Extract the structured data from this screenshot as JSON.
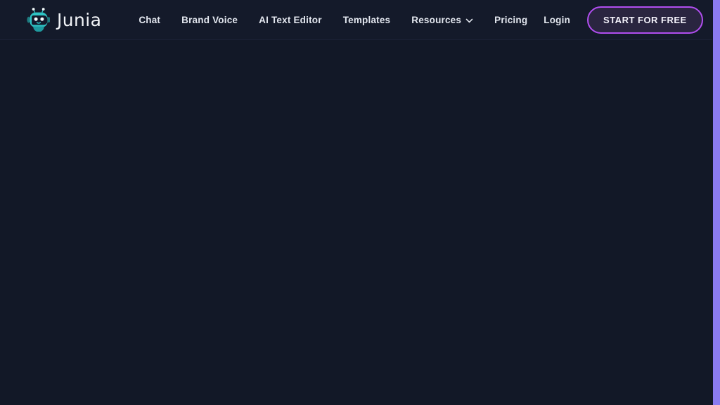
{
  "site": {
    "brand_name": "Junia",
    "brand_icon": "robot-mascot-icon",
    "background_color": "#121827",
    "header_color": "#141a2a",
    "accent_color": "#b14ef0",
    "logo_color": "#2ec4c4",
    "scrollbar_color": "#8b7bf0"
  },
  "header": {
    "nav_items": [
      {
        "label": "Chat",
        "has_dropdown": false
      },
      {
        "label": "Brand Voice",
        "has_dropdown": false
      },
      {
        "label": "AI Text Editor",
        "has_dropdown": false
      },
      {
        "label": "Templates",
        "has_dropdown": false
      },
      {
        "label": "Resources",
        "has_dropdown": true,
        "icon": "chevron-down-icon"
      },
      {
        "label": "Pricing",
        "has_dropdown": false
      }
    ],
    "login_label": "Login",
    "cta_label": "START FOR FREE"
  },
  "main": {
    "content": ""
  }
}
